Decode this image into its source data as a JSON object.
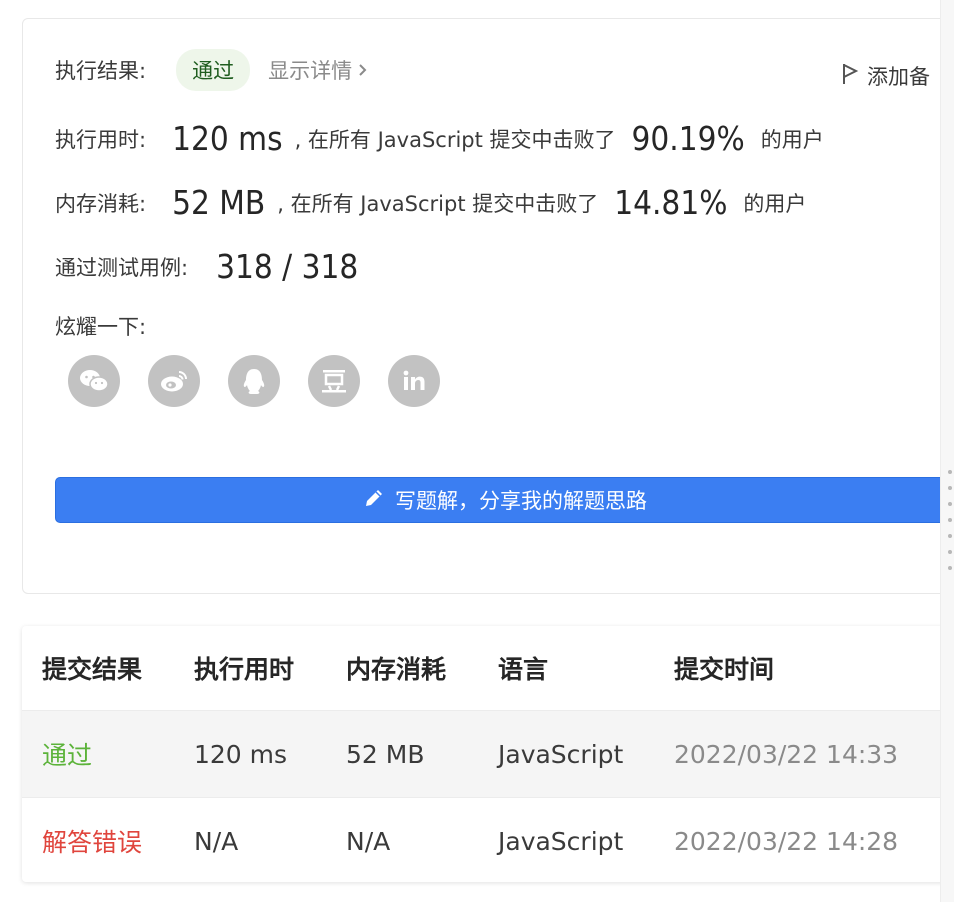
{
  "result": {
    "label": "执行结果:",
    "status": "通过",
    "details_link": "显示详情",
    "add_note": "添加备"
  },
  "runtime": {
    "label": "执行用时:",
    "value": "120 ms",
    "text_before": ", 在所有 JavaScript 提交中击败了",
    "percent": "90.19%",
    "text_after": "的用户"
  },
  "memory": {
    "label": "内存消耗:",
    "value": "52 MB",
    "text_before": ", 在所有 JavaScript 提交中击败了",
    "percent": "14.81%",
    "text_after": "的用户"
  },
  "tests": {
    "label": "通过测试用例:",
    "value": "318 / 318"
  },
  "share": {
    "label": "炫耀一下:",
    "icons": [
      "wechat-icon",
      "weibo-icon",
      "qq-icon",
      "douban-icon",
      "linkedin-icon"
    ]
  },
  "write_button": "写题解，分享我的解题思路",
  "colors": {
    "primary": "#3b7ef2",
    "pass": "#5cb33a",
    "fail": "#e0453d"
  },
  "submissions": {
    "headers": [
      "提交结果",
      "执行用时",
      "内存消耗",
      "语言",
      "提交时间"
    ],
    "rows": [
      {
        "status": "通过",
        "runtime": "120 ms",
        "memory": "52 MB",
        "language": "JavaScript",
        "time": "2022/03/22 14:33"
      },
      {
        "status": "解答错误",
        "runtime": "N/A",
        "memory": "N/A",
        "language": "JavaScript",
        "time": "2022/03/22 14:28"
      }
    ]
  }
}
